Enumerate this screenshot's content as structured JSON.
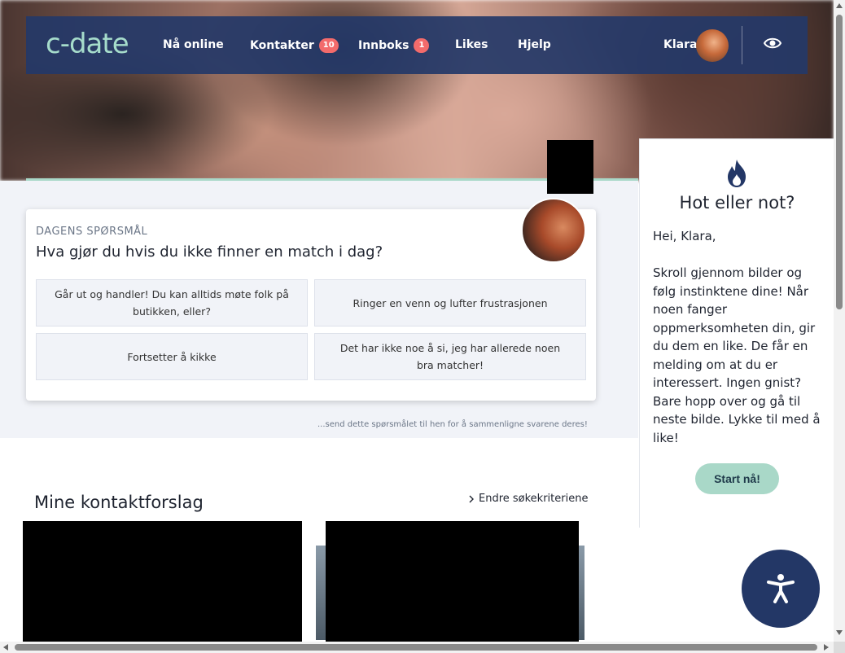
{
  "brand": {
    "logo_text": "c-date",
    "accent_color": "#a6dccb",
    "nav_color": "#243868"
  },
  "nav": {
    "items": [
      {
        "label": "Nå online"
      },
      {
        "label": "Kontakter",
        "badge": "10"
      },
      {
        "label": "Innboks",
        "badge": "1"
      },
      {
        "label": "Likes"
      },
      {
        "label": "Hjelp"
      }
    ],
    "user_name": "Klara",
    "eye_icon": "eye-icon"
  },
  "question": {
    "label": "DAGENS SPØRSMÅL",
    "title": "Hva gjør du hvis du ikke finner en match i dag?",
    "options": [
      "Går ut og handler! Du kan alltids møte folk på butikken, eller?",
      "Ringer en venn og lufter frustrasjonen",
      "Fortsetter å kikke",
      "Det har ikke noe å si, jeg har allerede noen bra matcher!"
    ],
    "send_note": "...send dette spørsmålet til hen for å sammenligne svarene deres!"
  },
  "contacts": {
    "title": "Mine kontaktforslag",
    "change_link": "Endre søkekriteriene"
  },
  "side_panel": {
    "icon": "flame-icon",
    "title": "Hot eller not?",
    "text": "Hei, Klara,\n\nSkroll gjennom bilder og følg instinktene dine! Når noen fanger oppmerksomheten din, gir du dem en like. De får en melding om at du er interessert. Ingen gnist? Bare hopp over og gå til neste bilde. Lykke til med å like!",
    "button": "Start nå!"
  },
  "accessibility": {
    "icon": "accessibility-icon"
  }
}
